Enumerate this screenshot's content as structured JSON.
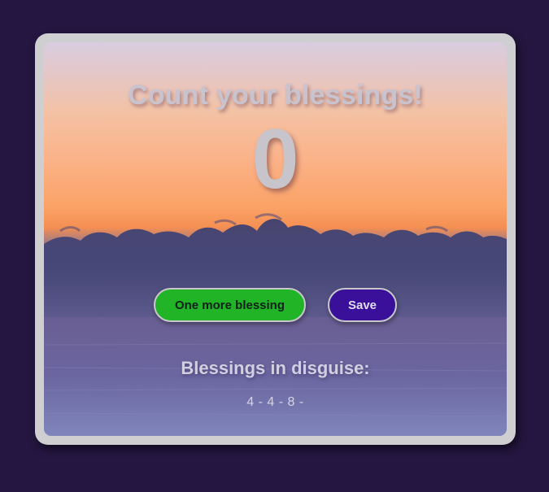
{
  "app": {
    "title": "Count your blessings!",
    "count": "0",
    "increment_label": "One more blessing",
    "save_label": "Save",
    "history_heading": "Blessings in disguise:",
    "history_text": "4 - 4 - 8 -"
  },
  "colors": {
    "page_background": "#241640",
    "frame": "#cfcfd2",
    "increment_button": "#20b426",
    "save_button": "#3a109a"
  }
}
